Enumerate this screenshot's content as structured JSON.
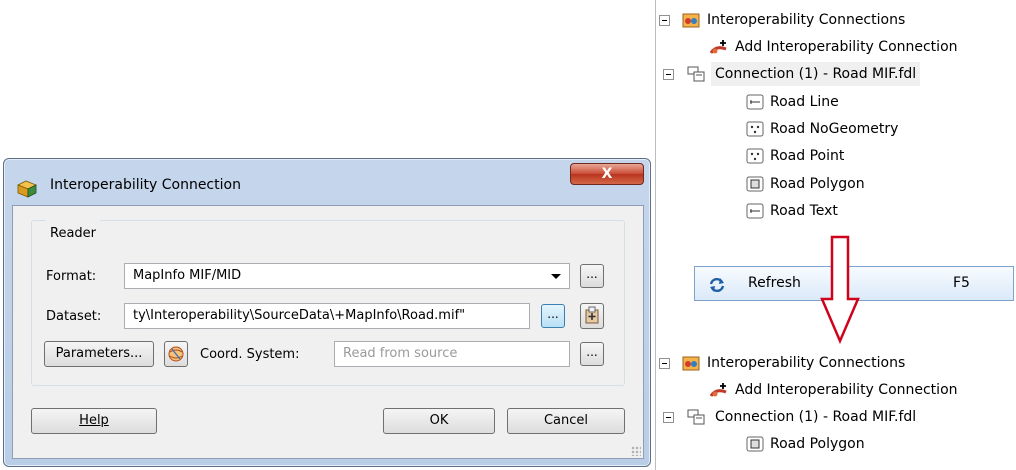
{
  "dialog": {
    "title": "Interoperability Connection",
    "close_label": "X",
    "reader_group_label": "Reader",
    "format_label": "Format:",
    "format_value": "MapInfo MIF/MID",
    "dataset_label": "Dataset:",
    "dataset_value": "ty\\Interoperability\\SourceData\\+MapInfo\\Road.mif\"",
    "browse_label": "...",
    "parameters_label": "Parameters...",
    "coord_label": "Coord. System:",
    "coord_placeholder": "Read from source",
    "help_label": "Help",
    "ok_label": "OK",
    "cancel_label": "Cancel"
  },
  "tree_before": {
    "root": "Interoperability Connections",
    "add": "Add Interoperability Connection",
    "connection": "Connection (1) - Road MIF.fdl",
    "layers": [
      {
        "label": "Road Line",
        "icon": "line-layer-icon"
      },
      {
        "label": "Road NoGeometry",
        "icon": "point-layer-icon"
      },
      {
        "label": "Road Point",
        "icon": "point-layer-icon"
      },
      {
        "label": "Road Polygon",
        "icon": "polygon-layer-icon"
      },
      {
        "label": "Road Text",
        "icon": "line-layer-icon"
      }
    ]
  },
  "context_menu": {
    "refresh_label": "Refresh",
    "refresh_shortcut": "F5"
  },
  "tree_after": {
    "root": "Interoperability Connections",
    "add": "Add Interoperability Connection",
    "connection": "Connection (1) - Road MIF.fdl",
    "layers": [
      {
        "label": "Road Polygon",
        "icon": "polygon-layer-icon"
      }
    ]
  },
  "colors": {
    "arrow": "#d0021b",
    "dialog_frame": "#c5d6ec",
    "close_button": "#c94b34"
  }
}
